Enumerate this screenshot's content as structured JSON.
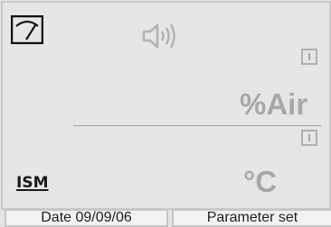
{
  "display": {
    "measurement_1": {
      "value": "",
      "unit": "%Air"
    },
    "measurement_2": {
      "value": "",
      "unit": "°C"
    },
    "logo": "ISM",
    "icons": {
      "gauge": "gauge-icon",
      "speaker": "speaker-icon",
      "info": "info-icon"
    }
  },
  "status_bar": {
    "date": "Date 09/09/06",
    "parameter_set": "Parameter set"
  }
}
